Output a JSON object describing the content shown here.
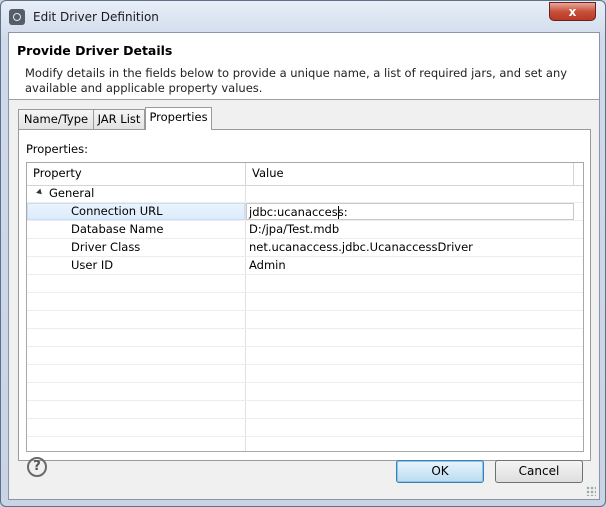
{
  "window": {
    "title": "Edit Driver Definition",
    "close_label": "x"
  },
  "header": {
    "title": "Provide Driver Details",
    "description": "Modify details in the fields below to provide a unique name, a list of required jars, and set any available and applicable property values."
  },
  "tabs": [
    {
      "label": "Name/Type",
      "active": false
    },
    {
      "label": "JAR List",
      "active": false
    },
    {
      "label": "Properties",
      "active": true
    }
  ],
  "properties": {
    "section_label": "Properties:",
    "columns": [
      "Property",
      "Value"
    ],
    "group": "General",
    "rows": [
      {
        "property": "Connection URL",
        "value": "jdbc:ucanaccess:",
        "selected": true
      },
      {
        "property": "Database Name",
        "value": "D:/jpa/Test.mdb",
        "selected": false
      },
      {
        "property": "Driver Class",
        "value": "net.ucanaccess.jdbc.UcanaccessDriver",
        "selected": false
      },
      {
        "property": "User ID",
        "value": "Admin",
        "selected": false
      }
    ]
  },
  "footer": {
    "help_label": "?",
    "ok_label": "OK",
    "cancel_label": "Cancel"
  }
}
